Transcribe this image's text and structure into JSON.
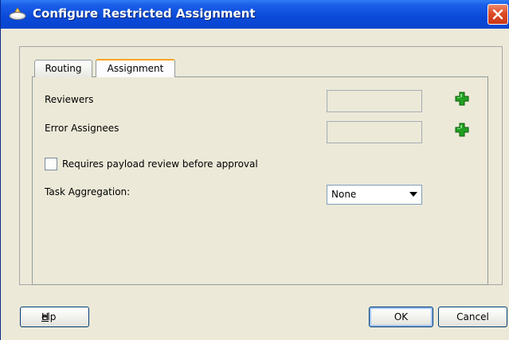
{
  "window": {
    "title": "Configure Restricted Assignment"
  },
  "tabs": [
    {
      "label": "Routing",
      "selected": false
    },
    {
      "label": "Assignment",
      "selected": true
    }
  ],
  "form": {
    "reviewers_label": "Reviewers",
    "reviewers_value": "",
    "error_assignees_label": "Error Assignees",
    "error_assignees_value": "",
    "payload_review_label": "Requires payload review before approval",
    "payload_review_checked": false,
    "task_aggregation_label": "Task Aggregation:",
    "task_aggregation_value": "None"
  },
  "buttons": {
    "help_mnemonic": "H",
    "help_rest": "elp",
    "ok": "OK",
    "cancel": "Cancel"
  },
  "colors": {
    "titlebar": "#0a49d8",
    "add_icon": "#22a022",
    "close": "#dc4b25",
    "selected_tab_accent": "#f5a524"
  },
  "icons": [
    "app-icon",
    "close-icon",
    "add-reviewer-icon",
    "add-error-assignee-icon",
    "dropdown-arrow-icon"
  ]
}
